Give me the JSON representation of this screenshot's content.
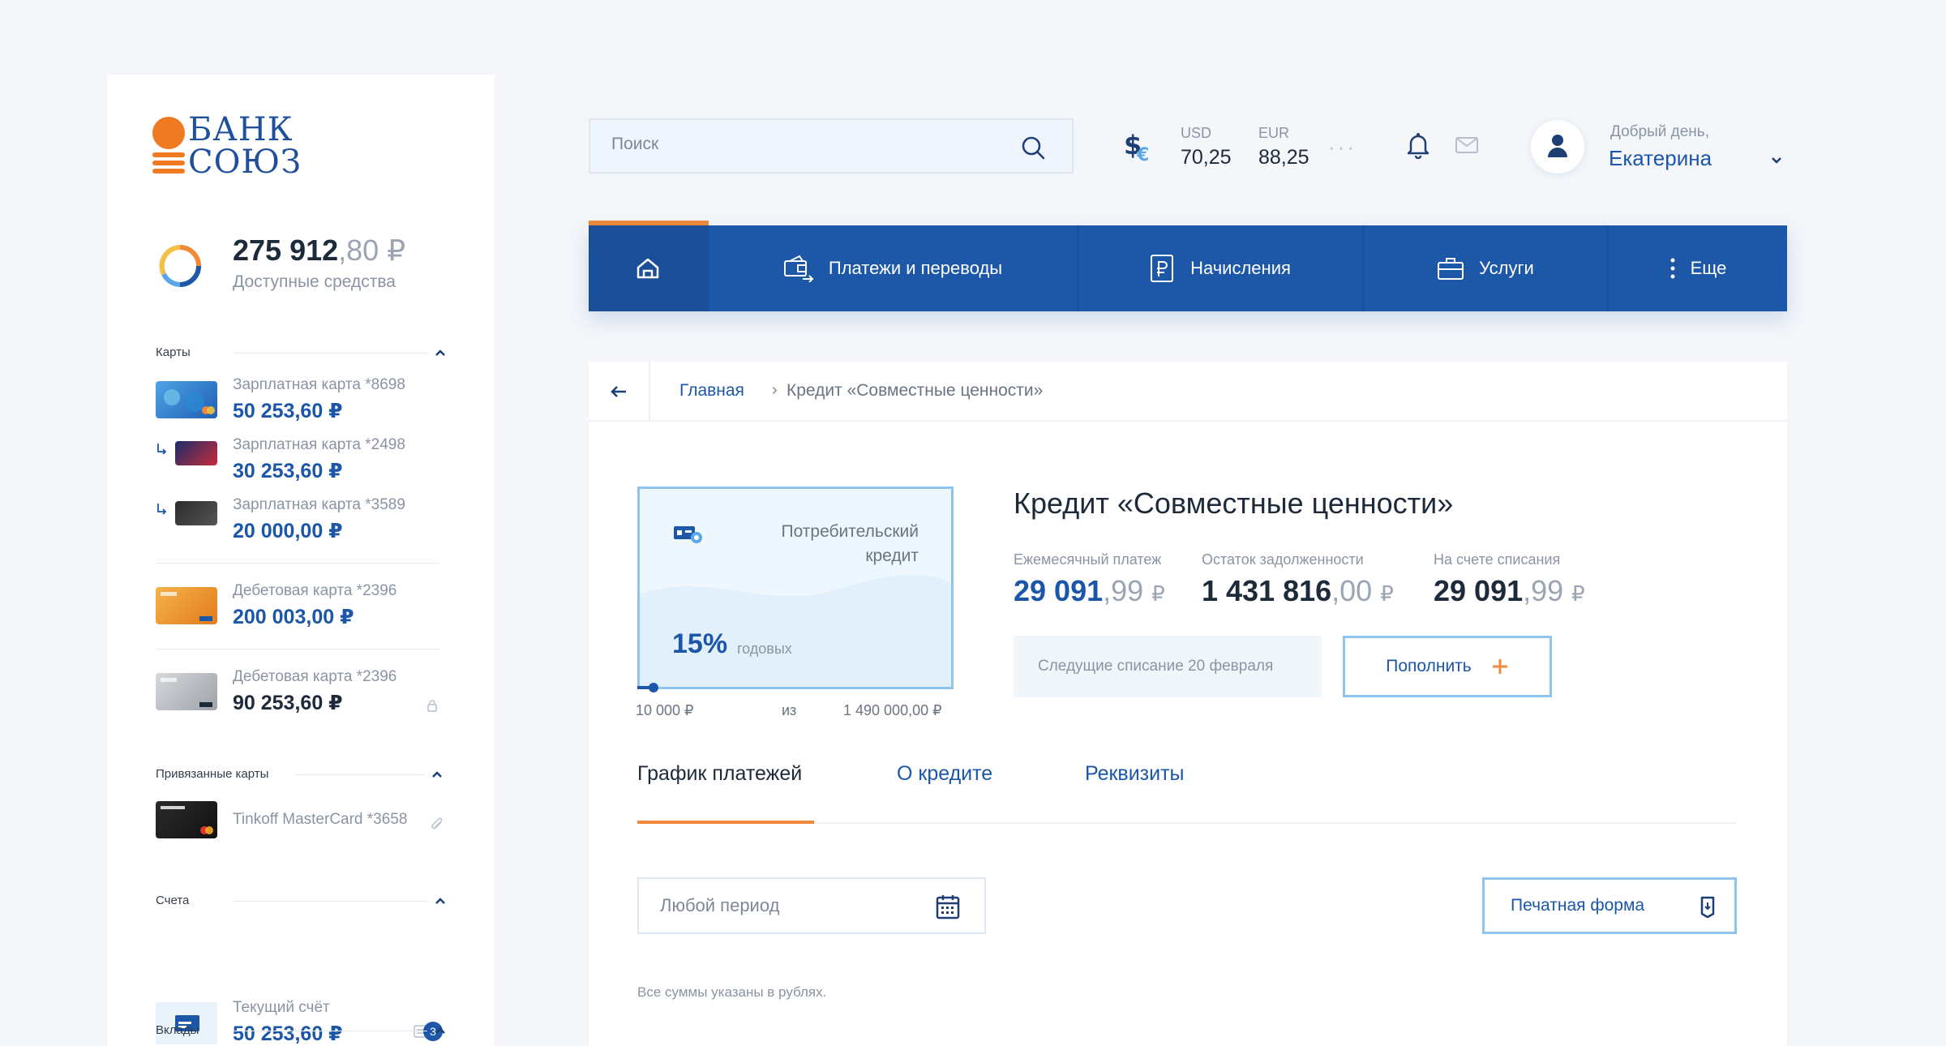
{
  "bank": {
    "logo_line1": "БАНК",
    "logo_line2": "СОЮЗ",
    "brand_orange": "#f08a3a",
    "brand_blue": "#1e4f9c"
  },
  "balance": {
    "integer": "275 912",
    "fraction": ",80",
    "currency": "₽",
    "label": "Доступные средства"
  },
  "sections": {
    "cards_title": "Карты",
    "linked_title": "Привязанные карты",
    "accounts_title": "Счета",
    "deposits_title": "Вклады"
  },
  "cards": [
    {
      "name": "Зарплатная карта *8698",
      "amount": "50 253,60 ₽"
    },
    {
      "name": "Зарплатная карта *2498",
      "amount": "30 253,60 ₽"
    },
    {
      "name": "Зарплатная карта *3589",
      "amount": "20 000,00 ₽"
    },
    {
      "name": "Дебетовая карта *2396",
      "amount": "200 003,00 ₽"
    },
    {
      "name": "Дебетовая карта *2396",
      "amount": "90 253,60 ₽"
    }
  ],
  "linked_cards": [
    {
      "name": "Tinkoff MasterCard *3658"
    }
  ],
  "accounts": [
    {
      "name": "Текущий счёт",
      "amount": "50 253,60 ₽",
      "badge": "3"
    }
  ],
  "search": {
    "placeholder": "Поиск"
  },
  "rates": {
    "usd_label": "USD",
    "usd_value": "70,25",
    "eur_label": "EUR",
    "eur_value": "88,25",
    "more": "···"
  },
  "user": {
    "greeting": "Добрый день,",
    "name": "Екатерина"
  },
  "nav": {
    "home_icon": "home-icon",
    "items": [
      {
        "label": "Платежи и переводы",
        "icon": "wallet-transfer-icon"
      },
      {
        "label": "Начисления",
        "icon": "ruble-document-icon"
      },
      {
        "label": "Услуги",
        "icon": "briefcase-icon"
      },
      {
        "label": "Еще",
        "icon": "vertical-dots-icon"
      }
    ]
  },
  "breadcrumb": {
    "home": "Главная",
    "separator": "›",
    "current": "Кредит «Совместные ценности»"
  },
  "loan": {
    "type": "Потребительский кредит",
    "rate": "15%",
    "rate_label": "годовых",
    "min": "10 000 ₽",
    "of": "из",
    "max": "1 490 000,00 ₽",
    "progress_fraction": 0.05,
    "title": "Кредит «Совместные ценности»",
    "monthly_label": "Ежемесячный платеж",
    "monthly_int": "29 091",
    "monthly_frac": ",99",
    "debt_label": "Остаток задолженности",
    "debt_int": "1 431 816",
    "debt_frac": ",00",
    "account_label": "На счете списания",
    "account_int": "29 091",
    "account_frac": ",99",
    "currency": "₽",
    "next_debit": "Следущие списание  20 февраля",
    "topup_label": "Пополнить"
  },
  "tabs": [
    {
      "label": "График платежей",
      "active": true
    },
    {
      "label": "О кредите",
      "active": false
    },
    {
      "label": "Реквизиты",
      "active": false
    }
  ],
  "schedule": {
    "period_placeholder": "Любой период",
    "print_label": "Печатная форма",
    "note": "Все суммы указаны в рублях."
  }
}
